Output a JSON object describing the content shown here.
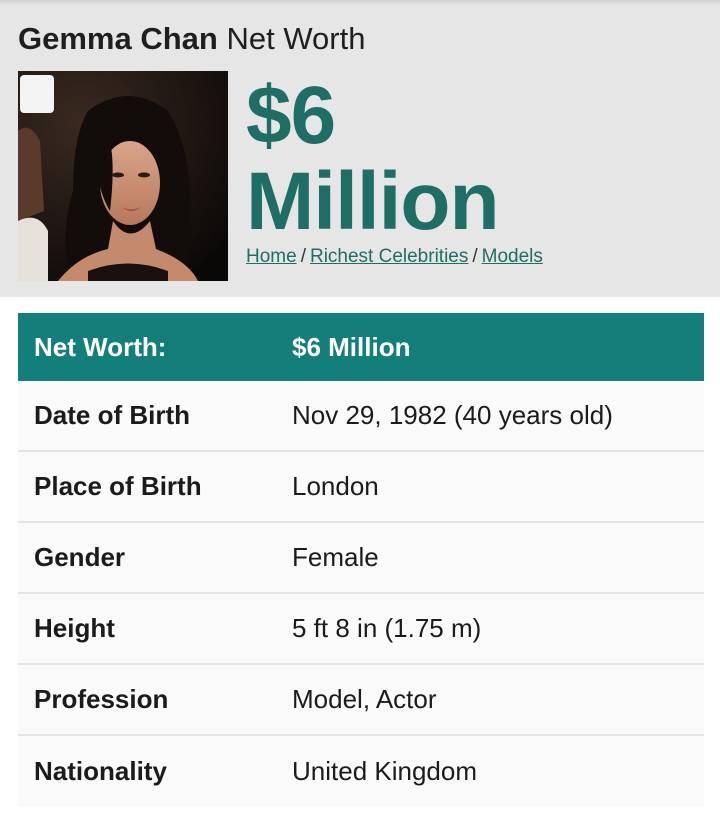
{
  "header": {
    "name": "Gemma Chan",
    "title_suffix": "Net Worth",
    "amount_line1": "$6",
    "amount_line2": "Million"
  },
  "breadcrumb": {
    "items": [
      "Home",
      "Richest Celebrities",
      "Models"
    ],
    "separator": "/"
  },
  "table": {
    "header": {
      "key": "Net Worth:",
      "value": "$6 Million"
    },
    "rows": [
      {
        "key": "Date of Birth",
        "value": "Nov 29, 1982 (40 years old)"
      },
      {
        "key": "Place of Birth",
        "value": "London"
      },
      {
        "key": "Gender",
        "value": "Female"
      },
      {
        "key": "Height",
        "value": "5 ft 8 in (1.75 m)"
      },
      {
        "key": "Profession",
        "value": "Model, Actor"
      },
      {
        "key": "Nationality",
        "value": "United Kingdom"
      }
    ]
  },
  "colors": {
    "accent": "#1f6e66",
    "table_header": "#147e7b",
    "header_bg": "#e6e6e6"
  }
}
